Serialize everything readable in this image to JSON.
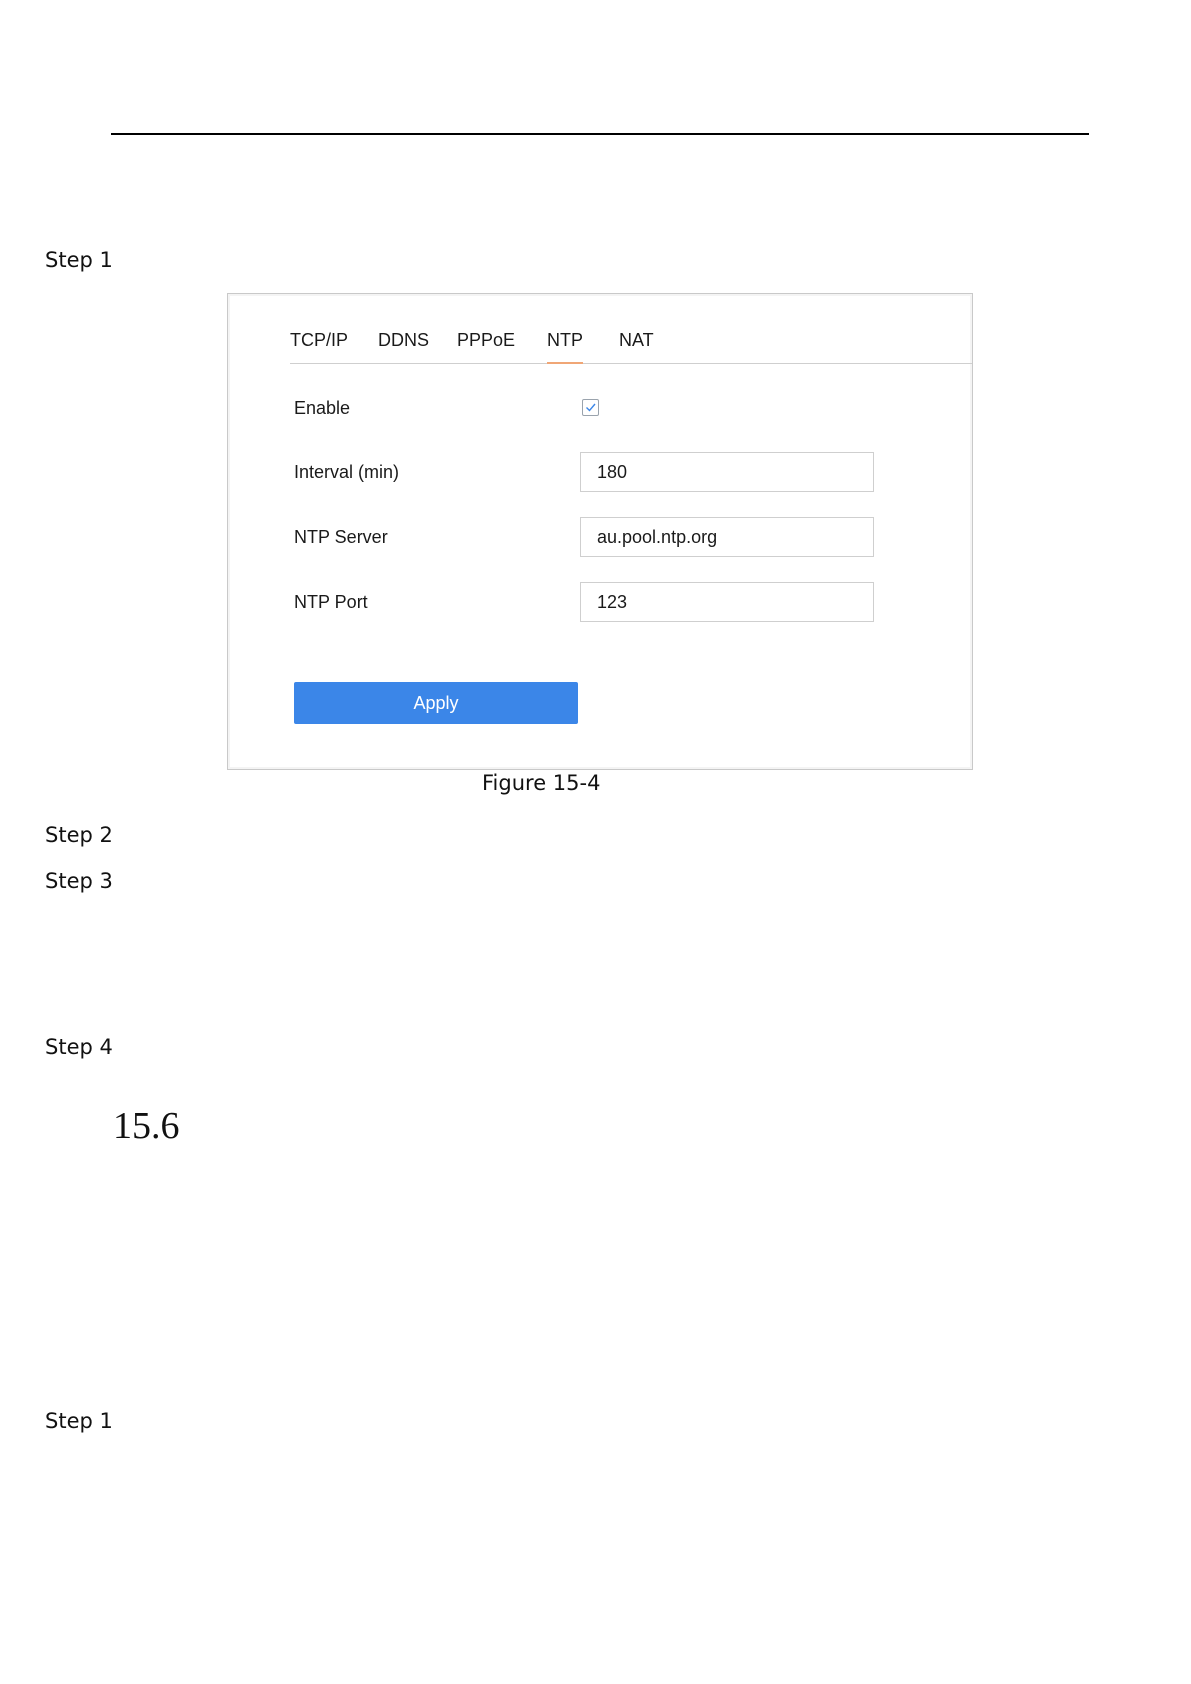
{
  "document": {
    "steps": {
      "step1_top": "Step 1",
      "step2": "Step 2",
      "step3": "Step 3",
      "step4": "Step 4",
      "step1_bottom": "Step 1"
    },
    "figure_caption": "Figure 15-4",
    "section_number": "15.6"
  },
  "ntp_panel": {
    "tabs": [
      {
        "label": "TCP/IP",
        "active": false
      },
      {
        "label": "DDNS",
        "active": false
      },
      {
        "label": "PPPoE",
        "active": false
      },
      {
        "label": "NTP",
        "active": true
      },
      {
        "label": "NAT",
        "active": false
      }
    ],
    "enable": {
      "label": "Enable",
      "checked": true
    },
    "interval": {
      "label": "Interval (min)",
      "value": "180"
    },
    "server": {
      "label": "NTP Server",
      "value": "au.pool.ntp.org"
    },
    "port": {
      "label": "NTP Port",
      "value": "123"
    },
    "apply_label": "Apply",
    "colors": {
      "accent_button": "#3b86e8",
      "active_tab_underline": "#f0a676"
    }
  }
}
